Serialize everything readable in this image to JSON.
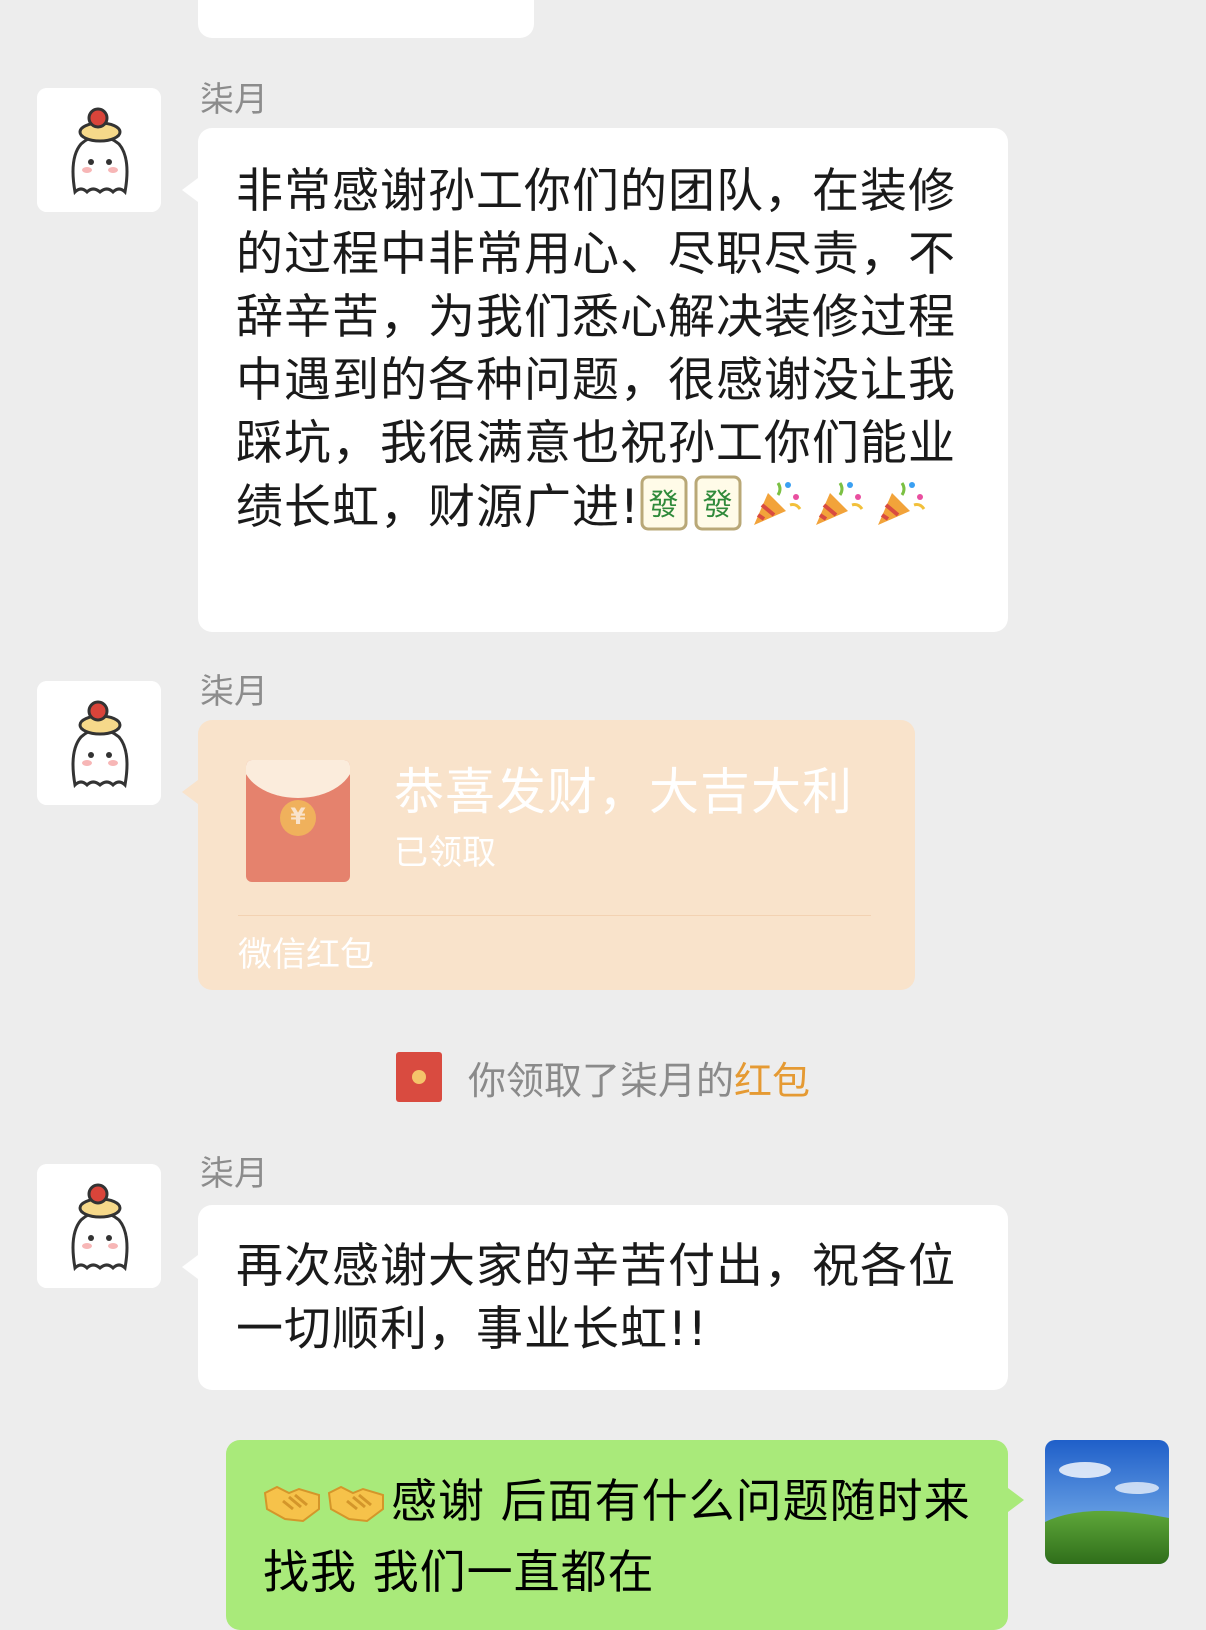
{
  "messages": [
    {
      "sender": "柒月",
      "text": "非常感谢孙工你们的团队，在装修的过程中非常用心、尽职尽责，不辞辛苦，为我们悉心解决装修过程中遇到的各种问题，很感谢没让我踩坑，我很满意也祝孙工你们能业绩长虹，财源广进!",
      "emojis": [
        "mahjong-fa-icon",
        "mahjong-fa-icon",
        "party-popper-icon",
        "party-popper-icon",
        "party-popper-icon"
      ]
    },
    {
      "sender": "柒月",
      "red_packet": {
        "title": "恭喜发财，大吉大利",
        "status": "已领取",
        "footer": "微信红包",
        "coin_glyph": "¥"
      }
    },
    {
      "sender": "柒月",
      "text": "再次感谢大家的辛苦付出，祝各位一切顺利，事业长虹!!"
    }
  ],
  "system_notice": {
    "prefix": "你领取了柒月的",
    "link": "红包"
  },
  "my_message": {
    "emojis": [
      "handshake-icon",
      "handshake-icon"
    ],
    "text": "感谢 后面有什么问题随时来找我 我们一直都在"
  },
  "colors": {
    "background": "#ededed",
    "bubble_white": "#ffffff",
    "bubble_green": "#a9ea7a",
    "red_packet_bg": "#f9e3cb",
    "link_orange": "#e59a33"
  }
}
